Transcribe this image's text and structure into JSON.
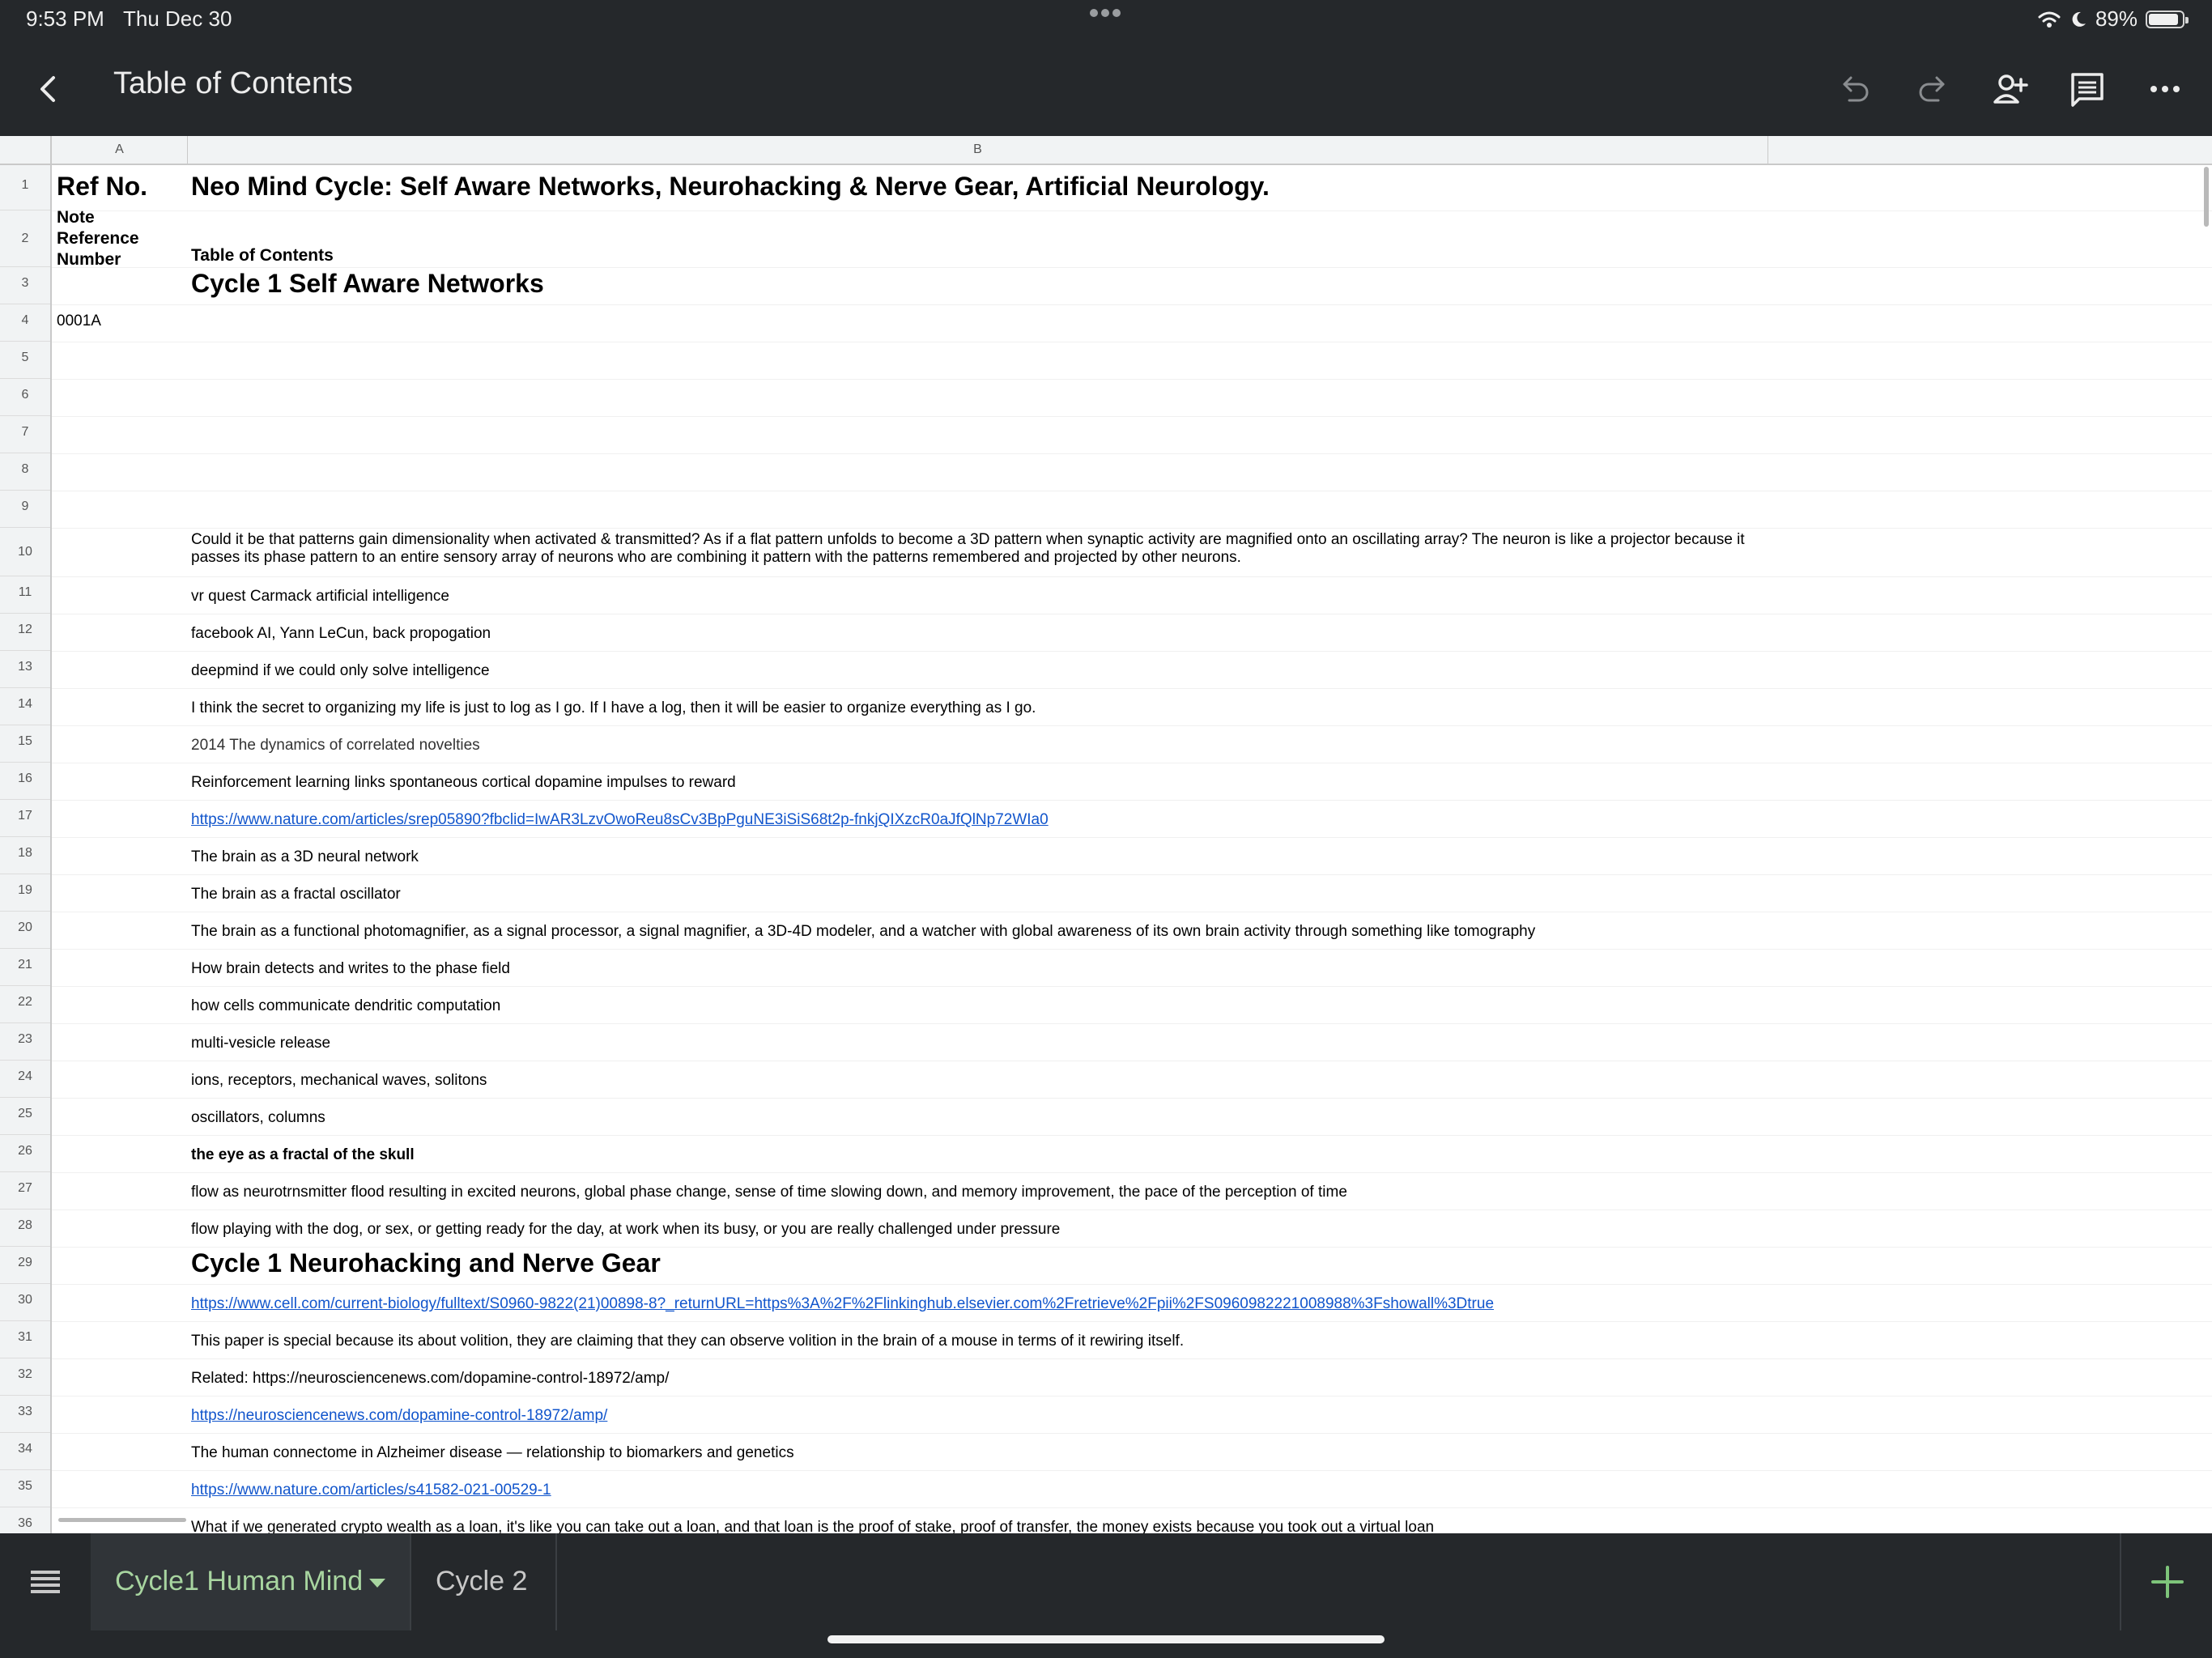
{
  "status_bar": {
    "time": "9:53 PM",
    "date": "Thu Dec 30",
    "battery": "89%",
    "battery_level": 0.89,
    "icons": [
      "wifi-icon",
      "moon-icon",
      "battery-icon"
    ]
  },
  "toolbar": {
    "title": "Table of Contents",
    "icons": [
      "back-icon",
      "undo-icon",
      "redo-icon",
      "add-person-icon",
      "comment-icon",
      "more-icon"
    ]
  },
  "columns": [
    "A",
    "B"
  ],
  "rows": [
    {
      "n": "1",
      "a": "Ref No.",
      "b": "Neo Mind Cycle: Self Aware Networks, Neurohacking & Nerve Gear, Artificial Neurology.",
      "style": "title"
    },
    {
      "n": "2",
      "a": "Note Reference Number",
      "b": "Table of Contents",
      "style": "header2"
    },
    {
      "n": "3",
      "a": "",
      "b": "Cycle 1 Self Aware Networks",
      "style": "section"
    },
    {
      "n": "4",
      "a": "0001A",
      "b": "",
      "style": "normal"
    },
    {
      "n": "5",
      "a": "",
      "b": "",
      "style": "normal"
    },
    {
      "n": "6",
      "a": "",
      "b": "",
      "style": "normal"
    },
    {
      "n": "7",
      "a": "",
      "b": "",
      "style": "normal"
    },
    {
      "n": "8",
      "a": "",
      "b": "",
      "style": "normal"
    },
    {
      "n": "9",
      "a": "",
      "b": "",
      "style": "normal"
    },
    {
      "n": "10",
      "a": "",
      "b": "Could it be that patterns gain dimensionality when activated & transmitted? As if a flat pattern unfolds to become a 3D pattern when synaptic activity are magnified onto an oscillating array? The neuron is like a projector because it passes its phase pattern to an entire sensory array of neurons who are combining it pattern with the patterns remembered and projected by other neurons.",
      "style": "wrap"
    },
    {
      "n": "11",
      "a": "",
      "b": "vr quest Carmack  artificial intelligence",
      "style": "normal"
    },
    {
      "n": "12",
      "a": "",
      "b": "facebook AI, Yann LeCun, back propogation",
      "style": "normal"
    },
    {
      "n": "13",
      "a": "",
      "b": "deepmind if we could only solve intelligence",
      "style": "normal"
    },
    {
      "n": "14",
      "a": "",
      "b": "I think the secret to organizing my life is just to log as I go. If I have a log, then it will be easier to organize everything as I go.",
      "style": "normal"
    },
    {
      "n": "15",
      "a": "",
      "b": "2014 The dynamics of correlated novelties",
      "style": "gray"
    },
    {
      "n": "16",
      "a": "",
      "b": "Reinforcement learning links spontaneous cortical dopamine impulses to reward",
      "style": "normal"
    },
    {
      "n": "17",
      "a": "",
      "b": "https://www.nature.com/articles/srep05890?fbclid=IwAR3LzvOwoReu8sCv3BpPguNE3iSiS68t2p-fnkjQIXzcR0aJfQlNp72WIa0",
      "style": "link"
    },
    {
      "n": "18",
      "a": "",
      "b": "The brain as a 3D neural network",
      "style": "normal"
    },
    {
      "n": "19",
      "a": "",
      "b": "The brain as a fractal oscillator",
      "style": "normal"
    },
    {
      "n": "20",
      "a": "",
      "b": "The brain as a functional photomagnifier, as a signal processor, a signal magnifier, a 3D-4D modeler, and a watcher with global awareness of its own brain activity through something like tomography",
      "style": "normal"
    },
    {
      "n": "21",
      "a": "",
      "b": "How brain detects and writes to the phase field",
      "style": "normal"
    },
    {
      "n": "22",
      "a": "",
      "b": "how cells communicate dendritic computation",
      "style": "normal"
    },
    {
      "n": "23",
      "a": "",
      "b": "multi-vesicle release",
      "style": "normal"
    },
    {
      "n": "24",
      "a": "",
      "b": "ions, receptors, mechanical waves, solitons",
      "style": "normal"
    },
    {
      "n": "25",
      "a": "",
      "b": "oscillators, columns",
      "style": "normal"
    },
    {
      "n": "26",
      "a": "",
      "b": "the eye as a fractal of the skull",
      "style": "bold"
    },
    {
      "n": "27",
      "a": "",
      "b": "flow as neurotrnsmitter flood resulting in excited neurons, global phase change, sense of time slowing down, and memory improvement, the pace of the perception of time",
      "style": "normal"
    },
    {
      "n": "28",
      "a": "",
      "b": "flow playing with the dog, or sex, or getting ready for the day, at work when its busy, or you are really challenged under pressure",
      "style": "normal"
    },
    {
      "n": "29",
      "a": "",
      "b": "Cycle 1 Neurohacking and Nerve Gear",
      "style": "section"
    },
    {
      "n": "30",
      "a": "",
      "b": "https://www.cell.com/current-biology/fulltext/S0960-9822(21)00898-8?_returnURL=https%3A%2F%2Flinkinghub.elsevier.com%2Fretrieve%2Fpii%2FS0960982221008988%3Fshowall%3Dtrue",
      "style": "link"
    },
    {
      "n": "31",
      "a": "",
      "b": "This paper is special because its about volition, they are claiming that they can observe volition in the brain of a mouse in terms of it rewiring itself.",
      "style": "normal"
    },
    {
      "n": "32",
      "a": "",
      "b": " Related: https://neurosciencenews.com/dopamine-control-18972/amp/",
      "style": "normal"
    },
    {
      "n": "33",
      "a": "",
      "b": "https://neurosciencenews.com/dopamine-control-18972/amp/",
      "style": "link"
    },
    {
      "n": "34",
      "a": "",
      "b": "The human connectome in Alzheimer disease — relationship to biomarkers and genetics",
      "style": "normal"
    },
    {
      "n": "35",
      "a": "",
      "b": "https://www.nature.com/articles/s41582-021-00529-1",
      "style": "link"
    },
    {
      "n": "36",
      "a": "",
      "b": "What if we generated crypto wealth as a loan, it's like you can take out a loan, and that loan is the proof of stake, proof of transfer, the money exists because you took out a virtual loan",
      "style": "normal"
    }
  ],
  "tabs": [
    {
      "label": "Cycle1 Human Mind",
      "active": true
    },
    {
      "label": "Cycle 2",
      "active": false
    }
  ],
  "colors": {
    "chrome": "#25282b",
    "active_tab_text": "#a8d5a0",
    "link": "#1155cc"
  }
}
